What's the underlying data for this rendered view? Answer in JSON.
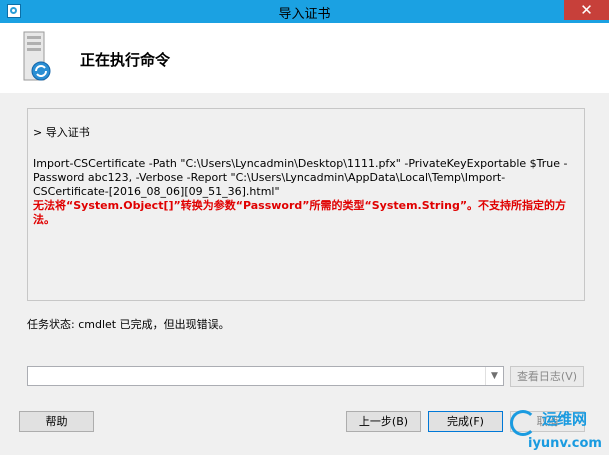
{
  "window": {
    "title": "导入证书",
    "close_glyph": "✕"
  },
  "header": {
    "heading": "正在执行命令"
  },
  "log": {
    "step": "> 导入证书",
    "command": "Import-CSCertificate -Path \"C:\\Users\\Lyncadmin\\Desktop\\1111.pfx\" -PrivateKeyExportable $True -Password abc123, -Verbose -Report \"C:\\Users\\Lyncadmin\\AppData\\Local\\Temp\\Import-CSCertificate-[2016_08_06][09_51_36].html\"",
    "error": "无法将“System.Object[]”转换为参数“Password”所需的类型“System.String”。不支持所指定的方法。"
  },
  "status": {
    "text": "任务状态: cmdlet 已完成，但出现错误。"
  },
  "log_select": {
    "value": "",
    "arrow_glyph": "▼"
  },
  "buttons": {
    "view_log": "查看日志(V)",
    "help": "帮助",
    "back": "上一步(B)",
    "finish": "完成(F)",
    "cancel": "取消"
  },
  "watermark": {
    "cn": "运维网",
    "en": "iyunv.com"
  },
  "colors": {
    "titlebar": "#1ba1e2",
    "close": "#c7403a",
    "error": "#e00000"
  }
}
